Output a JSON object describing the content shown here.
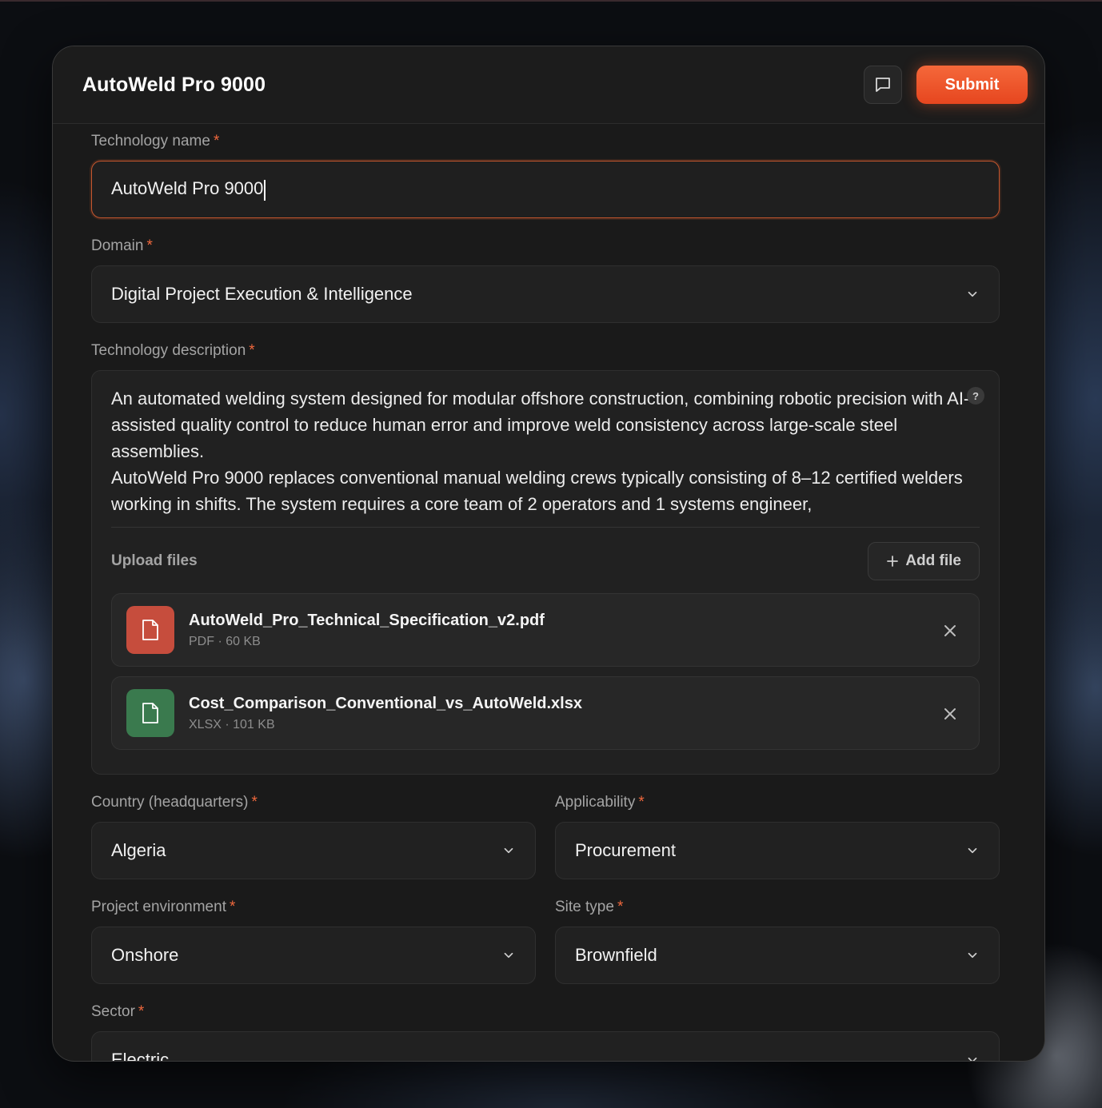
{
  "modal": {
    "title": "AutoWeld Pro 9000",
    "submit_label": "Submit"
  },
  "fields": {
    "technology_name": {
      "label": "Technology name",
      "value": "AutoWeld Pro 9000"
    },
    "domain": {
      "label": "Domain",
      "value": "Digital Project Execution & Intelligence"
    },
    "description": {
      "label": "Technology description",
      "value": "An automated welding system designed for modular offshore construction, combining robotic precision with AI-assisted quality control to reduce human error and improve weld consistency across large-scale steel assemblies.\nAutoWeld Pro 9000 replaces conventional manual welding crews typically consisting of 8–12 certified welders working in shifts. The system requires a core team of 2 operators and 1 systems engineer,",
      "help_glyph": "?"
    },
    "upload": {
      "label": "Upload files",
      "add_label": "Add file",
      "files": [
        {
          "name": "AutoWeld_Pro_Technical_Specification_v2.pdf",
          "meta": "PDF · 60 KB",
          "type": "pdf"
        },
        {
          "name": "Cost_Comparison_Conventional_vs_AutoWeld.xlsx",
          "meta": "XLSX · 101 KB",
          "type": "xlsx"
        }
      ]
    },
    "country": {
      "label": "Country (headquarters)",
      "value": "Algeria"
    },
    "applicability": {
      "label": "Applicability",
      "value": "Procurement"
    },
    "project_environment": {
      "label": "Project environment",
      "value": "Onshore"
    },
    "site_type": {
      "label": "Site type",
      "value": "Brownfield"
    },
    "sector": {
      "label": "Sector",
      "value": "Electric"
    }
  },
  "required_marker": "*",
  "colors": {
    "accent": "#f0683d",
    "pdf": "#c64d3d",
    "xlsx": "#3a7a4e"
  },
  "icons": [
    "chat-icon",
    "chevron-down-icon",
    "help-icon",
    "plus-icon",
    "file-icon",
    "close-icon"
  ]
}
